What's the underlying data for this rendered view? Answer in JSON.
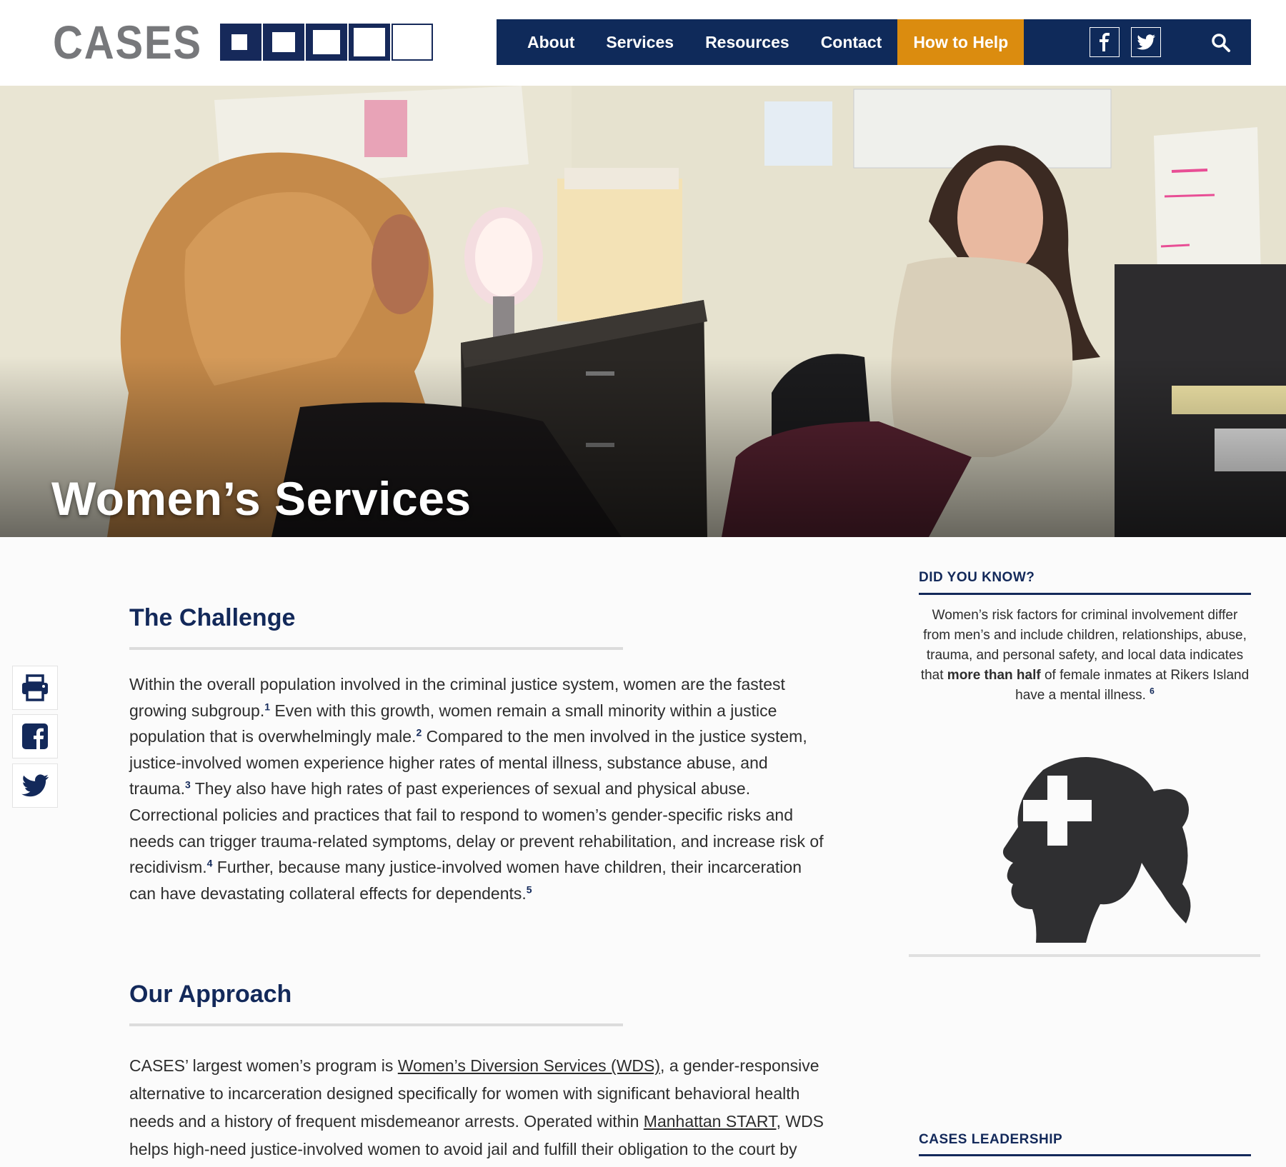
{
  "header": {
    "logo_text": "CASES",
    "nav": [
      {
        "label": "About"
      },
      {
        "label": "Services"
      },
      {
        "label": "Resources"
      },
      {
        "label": "Contact"
      },
      {
        "label": "How to Help"
      }
    ],
    "social_icons": [
      "facebook-icon",
      "twitter-icon"
    ],
    "search_icon": "search-icon"
  },
  "hero": {
    "title": "Women’s Services"
  },
  "share": {
    "icons": [
      "print-icon",
      "facebook-icon",
      "twitter-icon"
    ]
  },
  "challenge": {
    "title": "The Challenge",
    "p1": "Within the overall population involved in the criminal justice system, women are the fastest growing subgroup.",
    "fn1": "1",
    "p2": " Even with this growth, women remain a small minority within a justice population that is overwhelmingly male.",
    "fn2": "2",
    "p3": " Compared to the men involved in the justice system, justice-involved women experience higher rates of mental illness, substance abuse, and trauma.",
    "fn3": "3",
    "p4": " They also have high rates of past experiences of sexual and physical abuse. Correctional policies and practices that fail to respond to women’s gender-specific risks and needs can trigger trauma-related symptoms, delay or prevent rehabilitation, and increase risk of recidivism.",
    "fn4": "4",
    "p5": " Further, because many justice-involved women have children, their incarceration can have devastating collateral effects for dependents.",
    "fn5": "5"
  },
  "approach": {
    "title": "Our Approach",
    "t1": "CASES’ largest women’s program is ",
    "link1": "Women’s Diversion Services (WDS)",
    "t2": ", a gender-responsive alternative to incarceration designed specifically for women with significant behavioral health needs and a history of frequent misdemeanor arrests. Operated within ",
    "link2": "Manhattan START",
    "t3": ", WDS helps high-need justice-involved women to avoid jail and fulfill their obligation to the court by"
  },
  "sidebar": {
    "did_you_know_heading": "DID YOU KNOW?",
    "fact_1": "Women’s risk factors for criminal involvement differ from men’s and include children, relationships, abuse, trauma, and personal safety, and local data indicates that ",
    "fact_bold": "more than half",
    "fact_2": " of female inmates at Rikers Island have a mental illness.",
    "fact_fn": "6",
    "icon": "female-head-medical-cross-icon",
    "leadership_heading": "CASES LEADERSHIP"
  },
  "colors": {
    "navy": "#0f2a5a",
    "orange": "#db8c0f",
    "logo_gray": "#77787b"
  }
}
